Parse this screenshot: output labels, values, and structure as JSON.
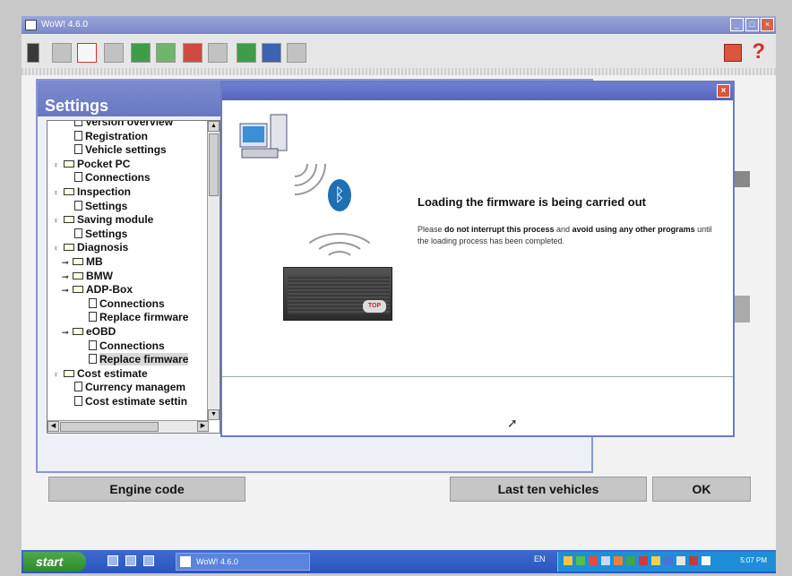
{
  "app": {
    "title": "WoW! 4.6.0"
  },
  "titlebar": {
    "min": "_",
    "max": "□",
    "close": "×"
  },
  "toolbar": {
    "help": "?",
    "icons": [
      "exit-icon",
      "vehicle-icon",
      "eobd-icon",
      "print-icon",
      "computer-icon",
      "document-icon",
      "car-icon",
      "tool-icon",
      "book-icon",
      "bluetooth-icon",
      "settings-icon",
      "flag-icon",
      "help-icon"
    ]
  },
  "settings": {
    "title": "Settings",
    "tree": [
      {
        "label": "Version overview",
        "level": 2,
        "type": "doc"
      },
      {
        "label": "Registration",
        "level": 2,
        "type": "doc"
      },
      {
        "label": "Vehicle settings",
        "level": 2,
        "type": "doc"
      },
      {
        "label": "Pocket PC",
        "level": 0,
        "type": "folder"
      },
      {
        "label": "Connections",
        "level": 2,
        "type": "doc"
      },
      {
        "label": "Inspection",
        "level": 0,
        "type": "folder"
      },
      {
        "label": "Settings",
        "level": 2,
        "type": "doc"
      },
      {
        "label": "Saving module",
        "level": 0,
        "type": "folder"
      },
      {
        "label": "Settings",
        "level": 2,
        "type": "doc"
      },
      {
        "label": "Diagnosis",
        "level": 0,
        "type": "folder"
      },
      {
        "label": "MB",
        "level": 1,
        "type": "folder"
      },
      {
        "label": "BMW",
        "level": 1,
        "type": "folder"
      },
      {
        "label": "ADP-Box",
        "level": 1,
        "type": "folder"
      },
      {
        "label": "Connections",
        "level": 3,
        "type": "doc"
      },
      {
        "label": "Replace firmware",
        "level": 3,
        "type": "doc"
      },
      {
        "label": "eOBD",
        "level": 1,
        "type": "folder"
      },
      {
        "label": "Connections",
        "level": 3,
        "type": "doc"
      },
      {
        "label": "Replace firmware",
        "level": 3,
        "type": "doc",
        "selected": true
      },
      {
        "label": "Cost estimate",
        "level": 0,
        "type": "folder"
      },
      {
        "label": "Currency managem",
        "level": 2,
        "type": "doc"
      },
      {
        "label": "Cost estimate settin",
        "level": 2,
        "type": "doc"
      }
    ]
  },
  "buttons": {
    "engine_code": "Engine code",
    "last_ten": "Last ten vehicles",
    "ok": "OK"
  },
  "modal": {
    "close": "×",
    "heading": "Loading the firmware is being carried out",
    "body_pre": "Please ",
    "body_b1": "do not interrupt this process",
    "body_mid": " and ",
    "body_b2": "avoid using any other programs",
    "body_post": " until the loading process has been completed.",
    "bluetooth_glyph": "ᛒ",
    "device_logo": "TOP"
  },
  "taskbar": {
    "start": "start",
    "task": "WoW! 4.6.0",
    "lang": "EN",
    "clock": "5:07 PM"
  }
}
